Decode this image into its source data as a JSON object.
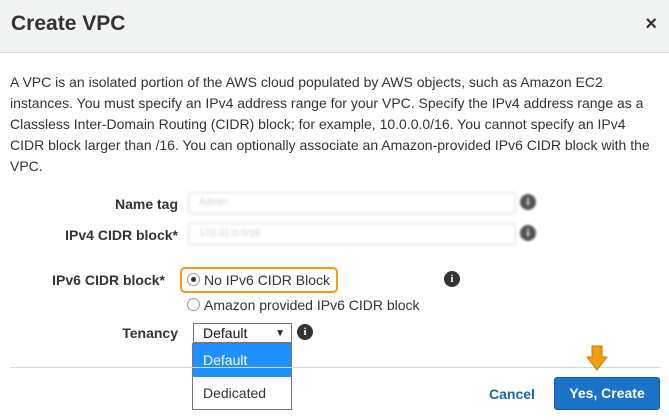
{
  "dialog": {
    "title": "Create VPC",
    "close_glyph": "×",
    "description": "A VPC is an isolated portion of the AWS cloud populated by AWS objects, such as Amazon EC2 instances. You must specify an IPv4 address range for your VPC. Specify the IPv4 address range as a Classless Inter-Domain Routing (CIDR) block; for example, 10.0.0.0/16. You cannot specify an IPv4 CIDR block larger than /16. You can optionally associate an Amazon-provided IPv6 CIDR block with the VPC."
  },
  "form": {
    "name_tag": {
      "label": "Name tag",
      "value": "Admin"
    },
    "ipv4": {
      "label": "IPv4 CIDR block*",
      "value": "172.31.0.0/16"
    },
    "ipv6": {
      "label": "IPv6 CIDR block*",
      "options": [
        {
          "label": "No IPv6 CIDR Block",
          "checked": true
        },
        {
          "label": "Amazon provided IPv6 CIDR block",
          "checked": false
        }
      ]
    },
    "tenancy": {
      "label": "Tenancy",
      "selected": "Default",
      "caret": "▼",
      "options": [
        "Default",
        "Dedicated"
      ]
    },
    "info_glyph": "i"
  },
  "footer": {
    "cancel_label": "Cancel",
    "create_label": "Yes, Create"
  },
  "colors": {
    "highlight": "#f39c12",
    "primary_button": "#1a73c8",
    "link": "#1a6aa8",
    "selected_option": "#1e90ff"
  },
  "icons": [
    "close-icon",
    "info-icon",
    "cursor-pointer-icon"
  ]
}
